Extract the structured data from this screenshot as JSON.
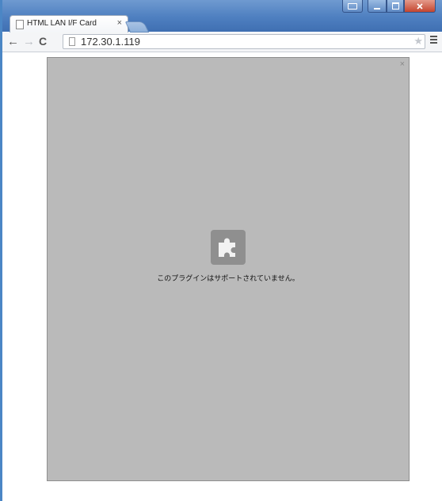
{
  "browser": {
    "tab": {
      "title": "HTML LAN I/F Card",
      "close": "×"
    },
    "toolbar": {
      "back": "←",
      "forward": "→",
      "reload": "C",
      "url": "172.30.1.119",
      "star": "★"
    }
  },
  "page": {
    "plugin": {
      "close": "×",
      "message": "このプラグインはサポートされていません。",
      "icon": "puzzle-piece-icon"
    }
  },
  "colors": {
    "titlebar": "#4e7fc0",
    "plugin_background": "#bababa",
    "plugin_icon": "#8f8f8f"
  }
}
